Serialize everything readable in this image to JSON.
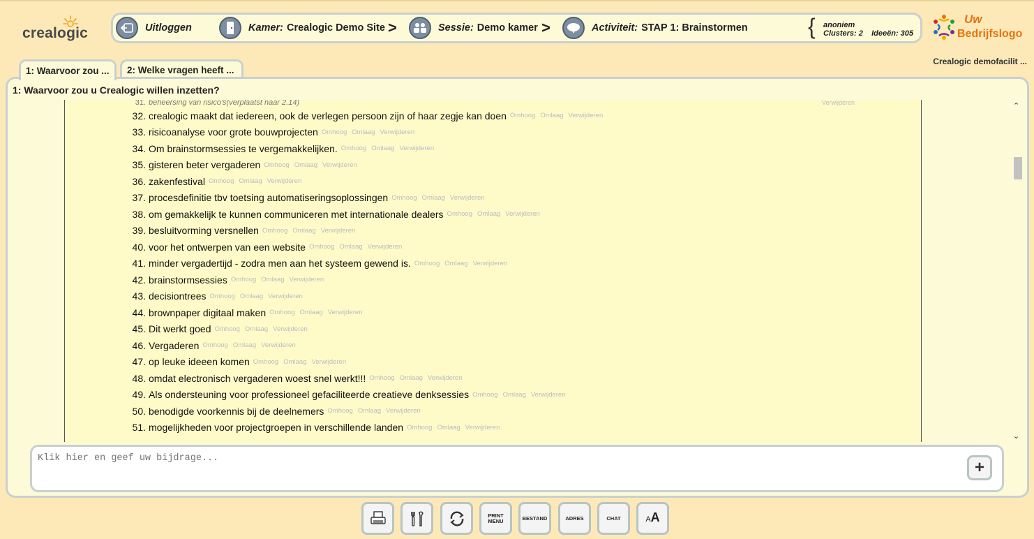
{
  "app": {
    "logo_text": "crealogic"
  },
  "header": {
    "logout_label": "Uitloggen",
    "room_label": "Kamer:",
    "room_value": "Crealogic Demo Site",
    "session_label": "Sessie:",
    "session_value": "Demo kamer",
    "activity_label": "Activiteit:",
    "activity_value": "STAP 1: Brainstormen",
    "separator": ">",
    "user": "anoniem",
    "clusters_text": "Clusters: 2",
    "ideas_text": "Ideeën: 305"
  },
  "company_logo": {
    "line1": "Uw",
    "line2": "Bedrijfslogo"
  },
  "facilitator": "Crealogic demofacilit ...",
  "tabs": [
    {
      "label": "1: Waarvoor zou ..."
    },
    {
      "label": "2: Welke vragen heeft ..."
    }
  ],
  "panel_title": "1: Waarvoor zou u Crealogic willen inzetten?",
  "actions": {
    "up": "Omhoog",
    "down": "Omlaag",
    "delete": "Verwijderen"
  },
  "moved_item": {
    "num": "31.",
    "text": "beheersing van risico's(verplaatst naar 2.14)",
    "action": "Verwijderen"
  },
  "ideas": [
    {
      "num": "32.",
      "text": "crealogic maakt dat iedereen, ook de verlegen persoon zijn of haar zegje kan doen"
    },
    {
      "num": "33.",
      "text": "risicoanalyse voor grote bouwprojecten"
    },
    {
      "num": "34.",
      "text": "Om brainstormsessies te vergemakkelijken."
    },
    {
      "num": "35.",
      "text": "gisteren beter vergaderen"
    },
    {
      "num": "36.",
      "text": "zakenfestival"
    },
    {
      "num": "37.",
      "text": "procesdefinitie tbv toetsing automatiseringsoplossingen"
    },
    {
      "num": "38.",
      "text": "om gemakkelijk te kunnen communiceren met internationale dealers"
    },
    {
      "num": "39.",
      "text": "besluitvorming versnellen"
    },
    {
      "num": "40.",
      "text": "voor het ontwerpen van een website"
    },
    {
      "num": "41.",
      "text": "minder vergadertijd - zodra men aan het systeem gewend is."
    },
    {
      "num": "42.",
      "text": "brainstormsessies"
    },
    {
      "num": "43.",
      "text": "decisiontrees"
    },
    {
      "num": "44.",
      "text": "brownpaper digitaal maken"
    },
    {
      "num": "45.",
      "text": "Dit werkt goed"
    },
    {
      "num": "46.",
      "text": "Vergaderen"
    },
    {
      "num": "47.",
      "text": "op leuke ideeen komen"
    },
    {
      "num": "48.",
      "text": "omdat electronisch vergaderen woest snel werkt!!!"
    },
    {
      "num": "49.",
      "text": "Als ondersteuning voor professioneel gefaciliteerde creatieve denksessies"
    },
    {
      "num": "50.",
      "text": "benodigde voorkennis bij de deelnemers"
    },
    {
      "num": "51.",
      "text": "mogelijkheden voor projectgroepen in verschillende landen"
    }
  ],
  "input": {
    "placeholder": "Klik hier en geef uw bijdrage..."
  },
  "add_button": "+",
  "toolbar": {
    "print_menu": "PRINT MENU",
    "bestand": "BESTAND",
    "adres": "ADRES",
    "chat": "CHAT",
    "font_size": "AA"
  },
  "colors": {
    "background": "#fde9b8",
    "panel": "#fdfad8",
    "list": "#fffbc8",
    "border": "#c8d0cf",
    "logo_orange": "#e8730c"
  }
}
